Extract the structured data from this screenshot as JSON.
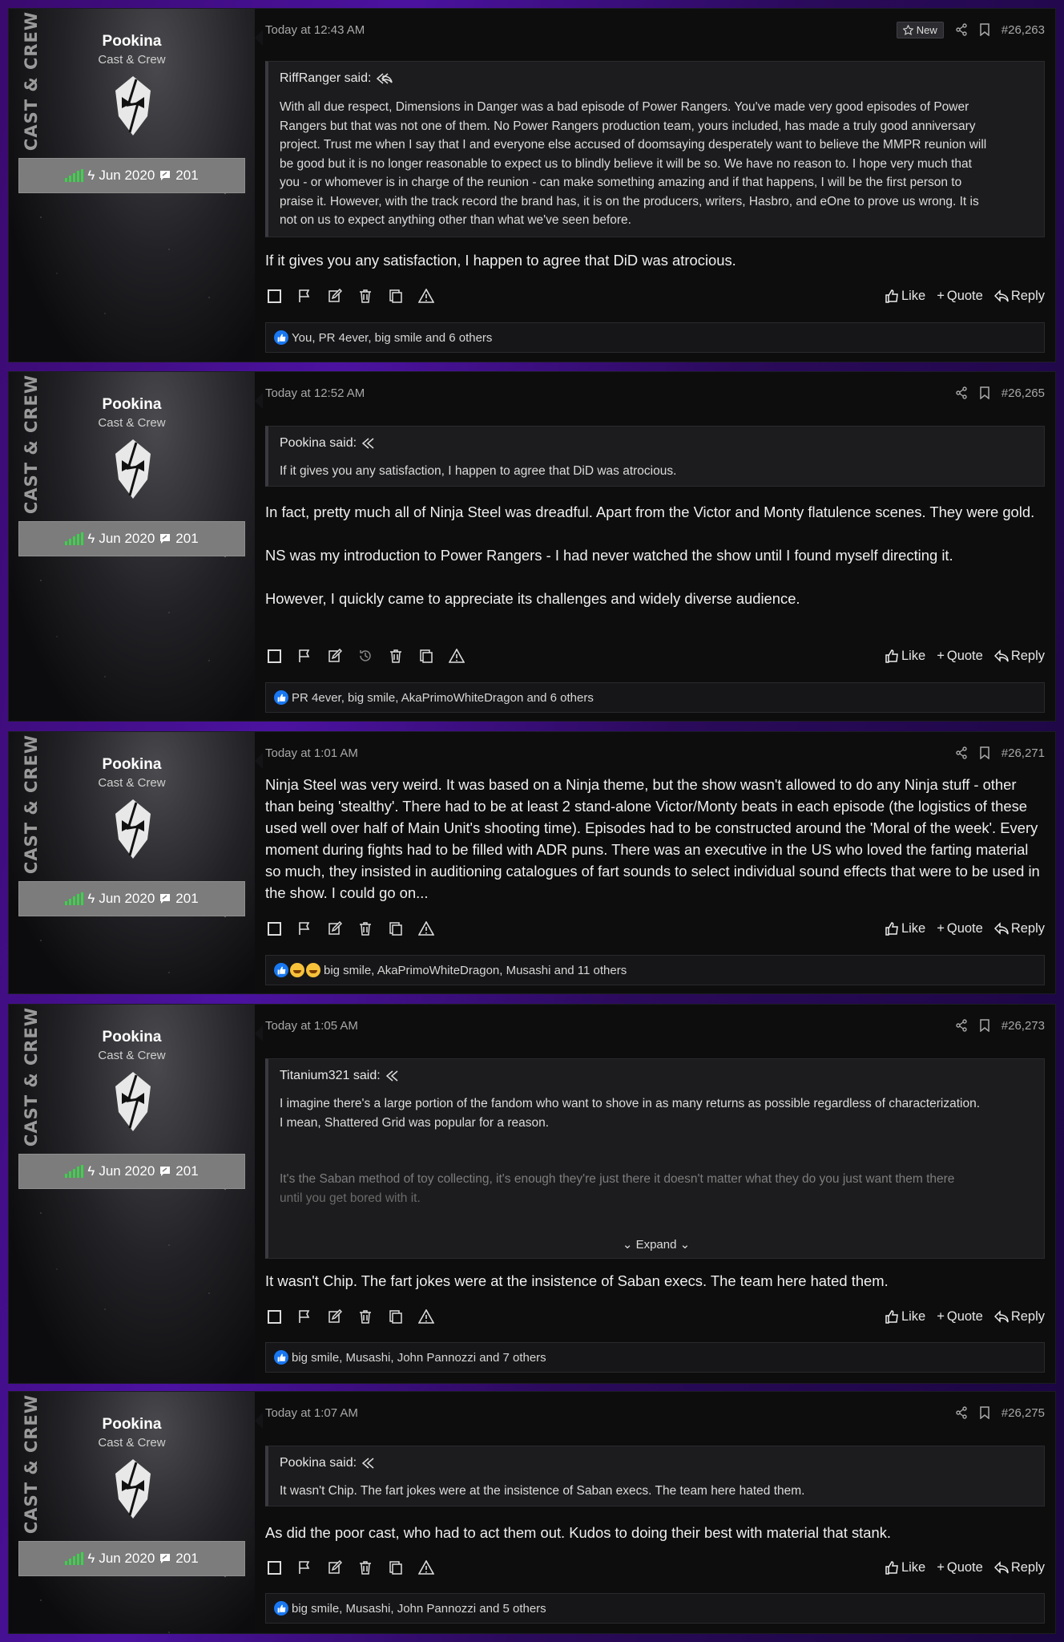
{
  "common": {
    "rank_vertical": "CAST & CREW",
    "username": "Pookina",
    "user_title": "Cast & Crew",
    "joined": "Jun 2020",
    "message_count": "201",
    "like_label": "Like",
    "quote_label": "Quote",
    "reply_label": "Reply"
  },
  "posts": [
    {
      "time": "Today at 12:43 AM",
      "new_badge": "New",
      "number": "#26,263",
      "quote": {
        "author": "RiffRanger said:",
        "lines": [
          "With all due respect, Dimensions in Danger was a bad episode of Power Rangers. You've made very good episodes of Power",
          "Rangers but that was not one of them. No Power Rangers production team, yours included, has made a truly good anniversary",
          "project. Trust me when I say that I and everyone else accused of doomsaying desperately want to believe the MMPR reunion will",
          "be good but it is no longer reasonable to expect us to blindly believe it will be so. We have no reason to. I hope very much that",
          "you - or whomever is in charge of the reunion - can make something amazing and if that happens, I will be the first person to",
          "praise it. However, with the track record the brand has, it is on the producers, writers, Hasbro, and eOne to prove us wrong. It is",
          "not on us to expect anything other than what we've seen before."
        ]
      },
      "paragraphs": [
        "If it gives you any satisfaction, I happen to agree that DiD was atrocious."
      ],
      "likes": "You, PR 4ever, big smile and 6 others"
    },
    {
      "time": "Today at 12:52 AM",
      "number": "#26,265",
      "quote": {
        "author": "Pookina said:",
        "lines": [
          "If it gives you any satisfaction, I happen to agree that DiD was atrocious."
        ]
      },
      "paragraphs": [
        "In fact, pretty much all of Ninja Steel was dreadful. Apart from the Victor and Monty flatulence scenes. They were gold.",
        "NS was my introduction to Power Rangers - I had never watched the show until I found myself directing it.",
        "However, I quickly came to appreciate its challenges and widely diverse audience."
      ],
      "likes": "PR 4ever, big smile, AkaPrimoWhiteDragon and 6 others"
    },
    {
      "time": "Today at 1:01 AM",
      "number": "#26,271",
      "paragraphs": [
        "Ninja Steel was very weird. It was based on a Ninja theme, but the show wasn't allowed to do any Ninja stuff - other than being 'stealthy'. There had to be at least 2 stand-alone Victor/Monty beats in each episode (the logistics of these used well over half of Main Unit's shooting time). Episodes had to be constructed around the 'Moral of the week'. Every moment during fights had to be filled with ADR puns. There was an executive in the US who loved the farting material so much, they insisted in auditioning catalogues of fart sounds to select individual sound effects that were to be used in the show. I could go on..."
      ],
      "likes": "big smile, AkaPrimoWhiteDragon, Musashi and 11 others"
    },
    {
      "time": "Today at 1:05 AM",
      "number": "#26,273",
      "quote": {
        "author": "Titanium321 said:",
        "lines": [
          "I imagine there's a large portion of the fandom who want to shove in as many returns as possible regardless of characterization.",
          "I mean, Shattered Grid was popular for a reason."
        ],
        "faded_lines": [
          "It's the Saban method of toy collecting, it's enough they're just there it doesn't matter what they do you just want them there",
          "until you get bored with it."
        ],
        "expand_label": "Expand"
      },
      "paragraphs": [
        "It wasn't Chip. The fart jokes were at the insistence of Saban execs. The team here hated them."
      ],
      "likes": "big smile, Musashi, John Pannozzi and 7 others"
    },
    {
      "time": "Today at 1:07 AM",
      "number": "#26,275",
      "quote": {
        "author": "Pookina said:",
        "lines": [
          "It wasn't Chip. The fart jokes were at the insistence of Saban execs. The team here hated them."
        ]
      },
      "paragraphs": [
        "As did the poor cast, who had to act them out. Kudos to doing their best with material that stank."
      ],
      "likes": "big smile, Musashi, John Pannozzi and 5 others"
    }
  ],
  "colors": {
    "background_purple": "#4b12a0",
    "post_bg": "#0d0d0e",
    "quote_bg": "#1c1c1e",
    "signal_green": "#3bd24a",
    "like_blue": "#1877f2"
  },
  "icons": [
    "star-icon",
    "share-icon",
    "bookmark-icon",
    "checkbox-icon",
    "flag-icon",
    "edit-icon",
    "history-icon",
    "trash-icon",
    "copy-icon",
    "warning-icon",
    "thumbs-up-icon",
    "plus-icon",
    "reply-icon",
    "quote-arrow-icon",
    "bolt-icon",
    "speech-bubble-icon",
    "signal-icon",
    "double-chevron-down-icon"
  ]
}
